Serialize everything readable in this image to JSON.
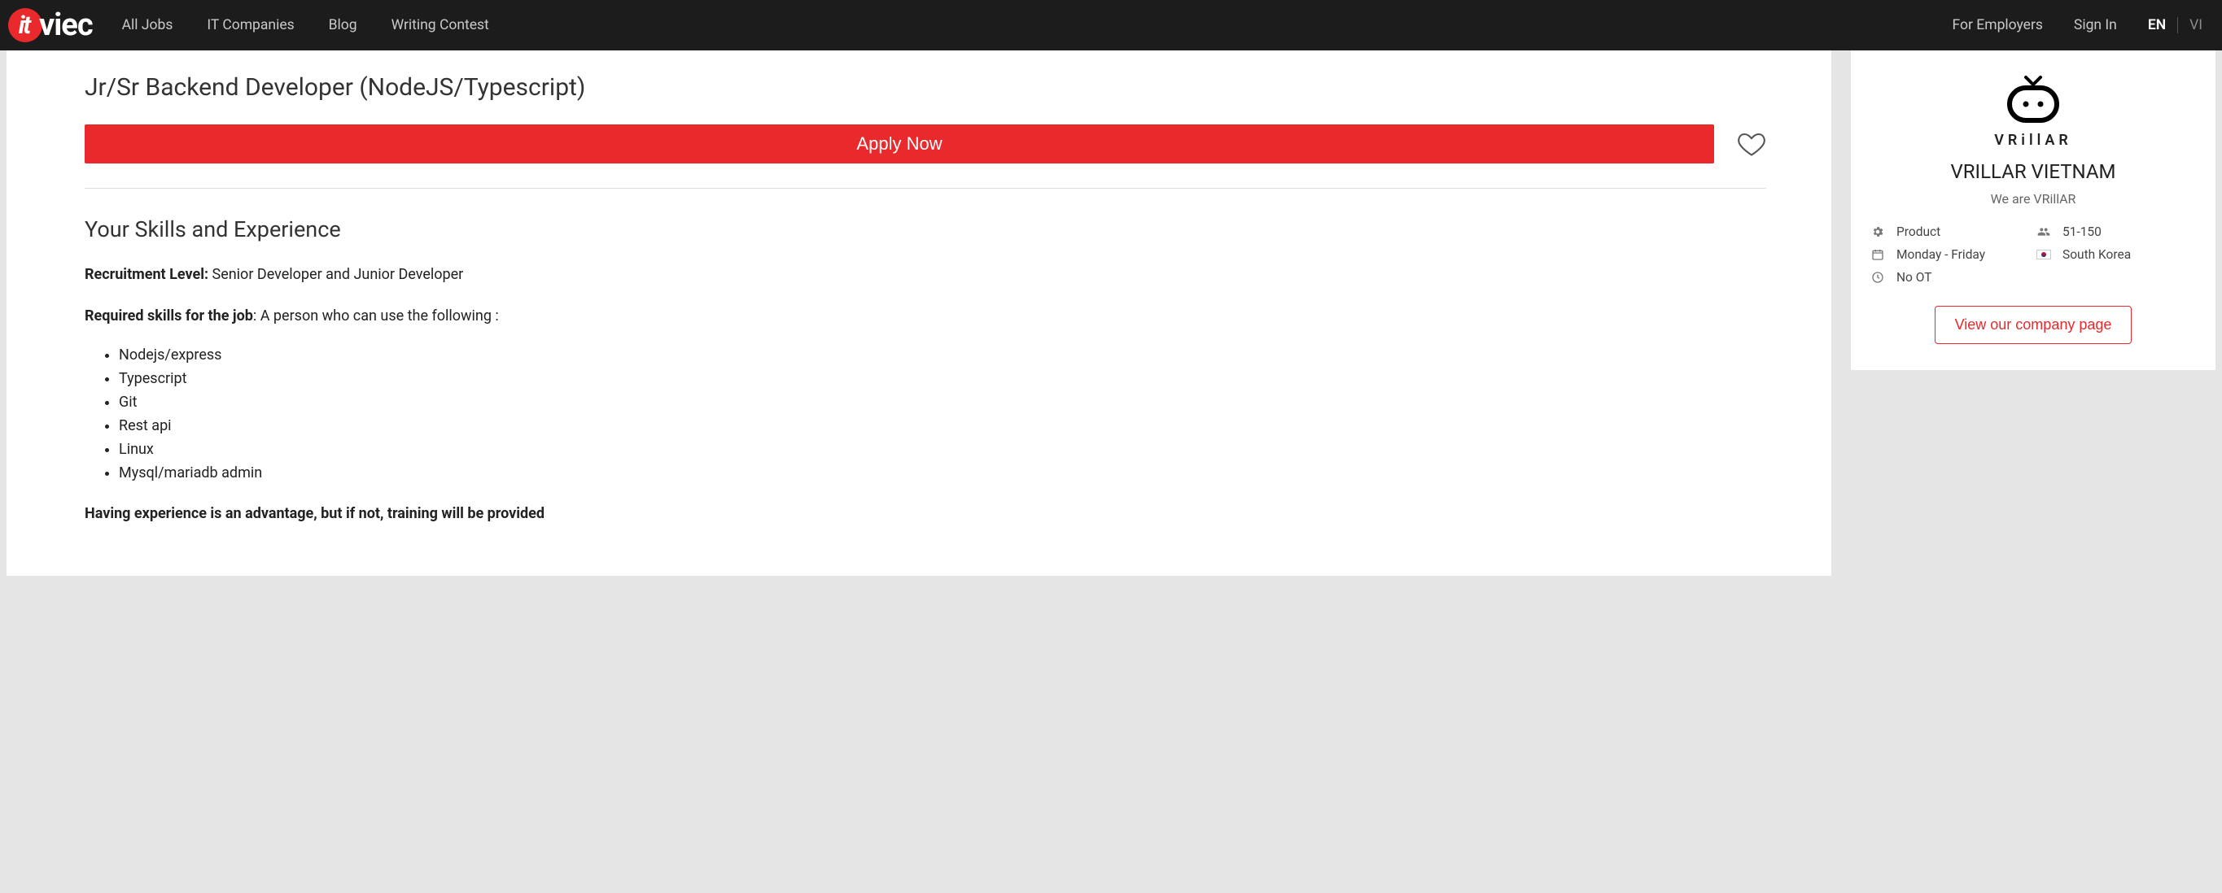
{
  "nav": {
    "logo_it": "it",
    "logo_viec": "viec",
    "links": [
      "All Jobs",
      "IT Companies",
      "Blog",
      "Writing Contest"
    ],
    "for_employers": "For Employers",
    "sign_in": "Sign In",
    "lang_en": "EN",
    "lang_vi": "VI"
  },
  "job": {
    "title": "Jr/Sr Backend Developer (NodeJS/Typescript)",
    "apply_label": "Apply Now",
    "skills_heading": "Your Skills and Experience",
    "recruitment_label": "Recruitment Level:",
    "recruitment_value": "Senior Developer and Junior Developer",
    "required_label": "Required skills for the job",
    "required_value": ": A person who can use the following :",
    "skills": [
      "Nodejs/express",
      "Typescript",
      "Git",
      "Rest api",
      "Linux",
      "Mysql/mariadb admin"
    ],
    "advantage_text": "Having experience is an advantage, but if not, training will be provided"
  },
  "company": {
    "name": "VRILLAR VIETNAM",
    "logo_text": "VRillAR",
    "tagline": "We are VRillAR",
    "type": "Product",
    "schedule": "Monday - Friday",
    "ot": "No OT",
    "size": "51-150",
    "country": "South Korea",
    "view_page_label": "View our company page"
  }
}
